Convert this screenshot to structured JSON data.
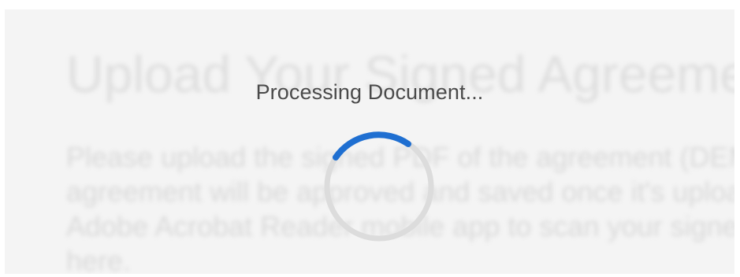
{
  "background": {
    "heading": "Upload Your Signed Agreement",
    "body_lines": [
      "Please upload the signed PDF of the agreement (DEMO U",
      "agreement will be approved and saved once it's uploaded a",
      "Adobe Acrobat Reader mobile app to scan your signed do",
      "here."
    ]
  },
  "overlay": {
    "message": "Processing Document...",
    "spinner_icon": "loading-spinner-icon"
  },
  "colors": {
    "panel_bg": "#f4f4f4",
    "spinner_track": "#dcdcdc",
    "spinner_accent": "#1f6fd1",
    "message_text": "#4a4a4a"
  }
}
